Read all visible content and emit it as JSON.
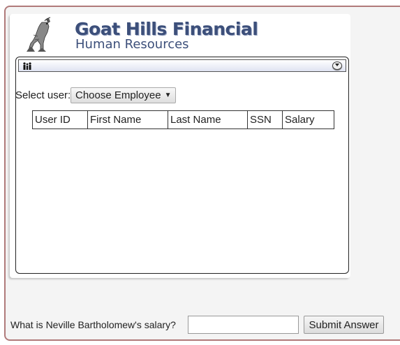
{
  "brand": {
    "title": "Goat Hills Financial",
    "subtitle": "Human Resources",
    "logo_icon": "goat-logo-icon"
  },
  "toolbar": {
    "left_icon": "people-icon",
    "right_icon": "collapse-toggle-icon"
  },
  "user_select": {
    "label": "Select user:",
    "selected": "Choose Employee",
    "caret": "▼"
  },
  "table": {
    "columns": [
      "User ID",
      "First Name",
      "Last Name",
      "SSN",
      "Salary"
    ],
    "rows": []
  },
  "question": {
    "text": "What is Neville Bartholomew's salary?",
    "input_value": "",
    "submit_label": "Submit Answer"
  },
  "colors": {
    "frame_border": "#b07a7a",
    "brand": "#3c4f7a"
  }
}
